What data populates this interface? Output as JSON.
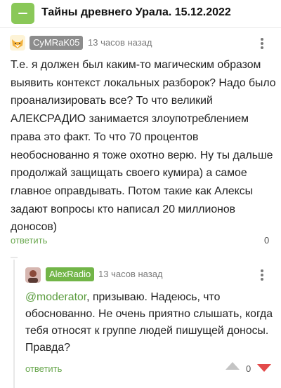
{
  "post": {
    "title": "Тайны древнего Урала. 15.12.2022",
    "collapse_icon": "minus-icon"
  },
  "comment_1": {
    "avatar_icon": "fox-avatar-icon",
    "author": "CyMRaK05",
    "time": "13 часов назад",
    "more_icon": "more-vertical-icon",
    "text": "Т.е. я должен был каким-то магическим образом выявить контекст локальных разборок? Надо было проанализировать все? То что великий АЛЕКСРАДИО занимается злоупотреблением права это факт. То что 70 процентов необоснованно я тоже охотно верю. Ну ты дальше продолжай защищать своего кумира) а самое главное оправдывать. Потом такие как Алексы задают вопросы кто написал 20 миллионов доносов)",
    "reply_label": "ответить",
    "rating": "0"
  },
  "comment_2": {
    "avatar_icon": "user-avatar-icon",
    "author": "AlexRadio",
    "time": "13 часов назад",
    "more_icon": "more-vertical-icon",
    "mention": "@moderator",
    "text": ", призываю. Надеюсь, что обоснованно. Не очень приятно слышать, когда тебя относят к группе людей пишущей доносы. Правда?",
    "reply_label": "ответить",
    "rating": "0",
    "upvote_icon": "upvote-icon",
    "downvote_icon": "downvote-icon"
  },
  "colors": {
    "accent_green": "#8ac858",
    "link_green": "#6aa84f",
    "author2_badge": "#72b548",
    "author1_badge": "#8c8c8c",
    "downvote_red": "#e34a4a"
  }
}
